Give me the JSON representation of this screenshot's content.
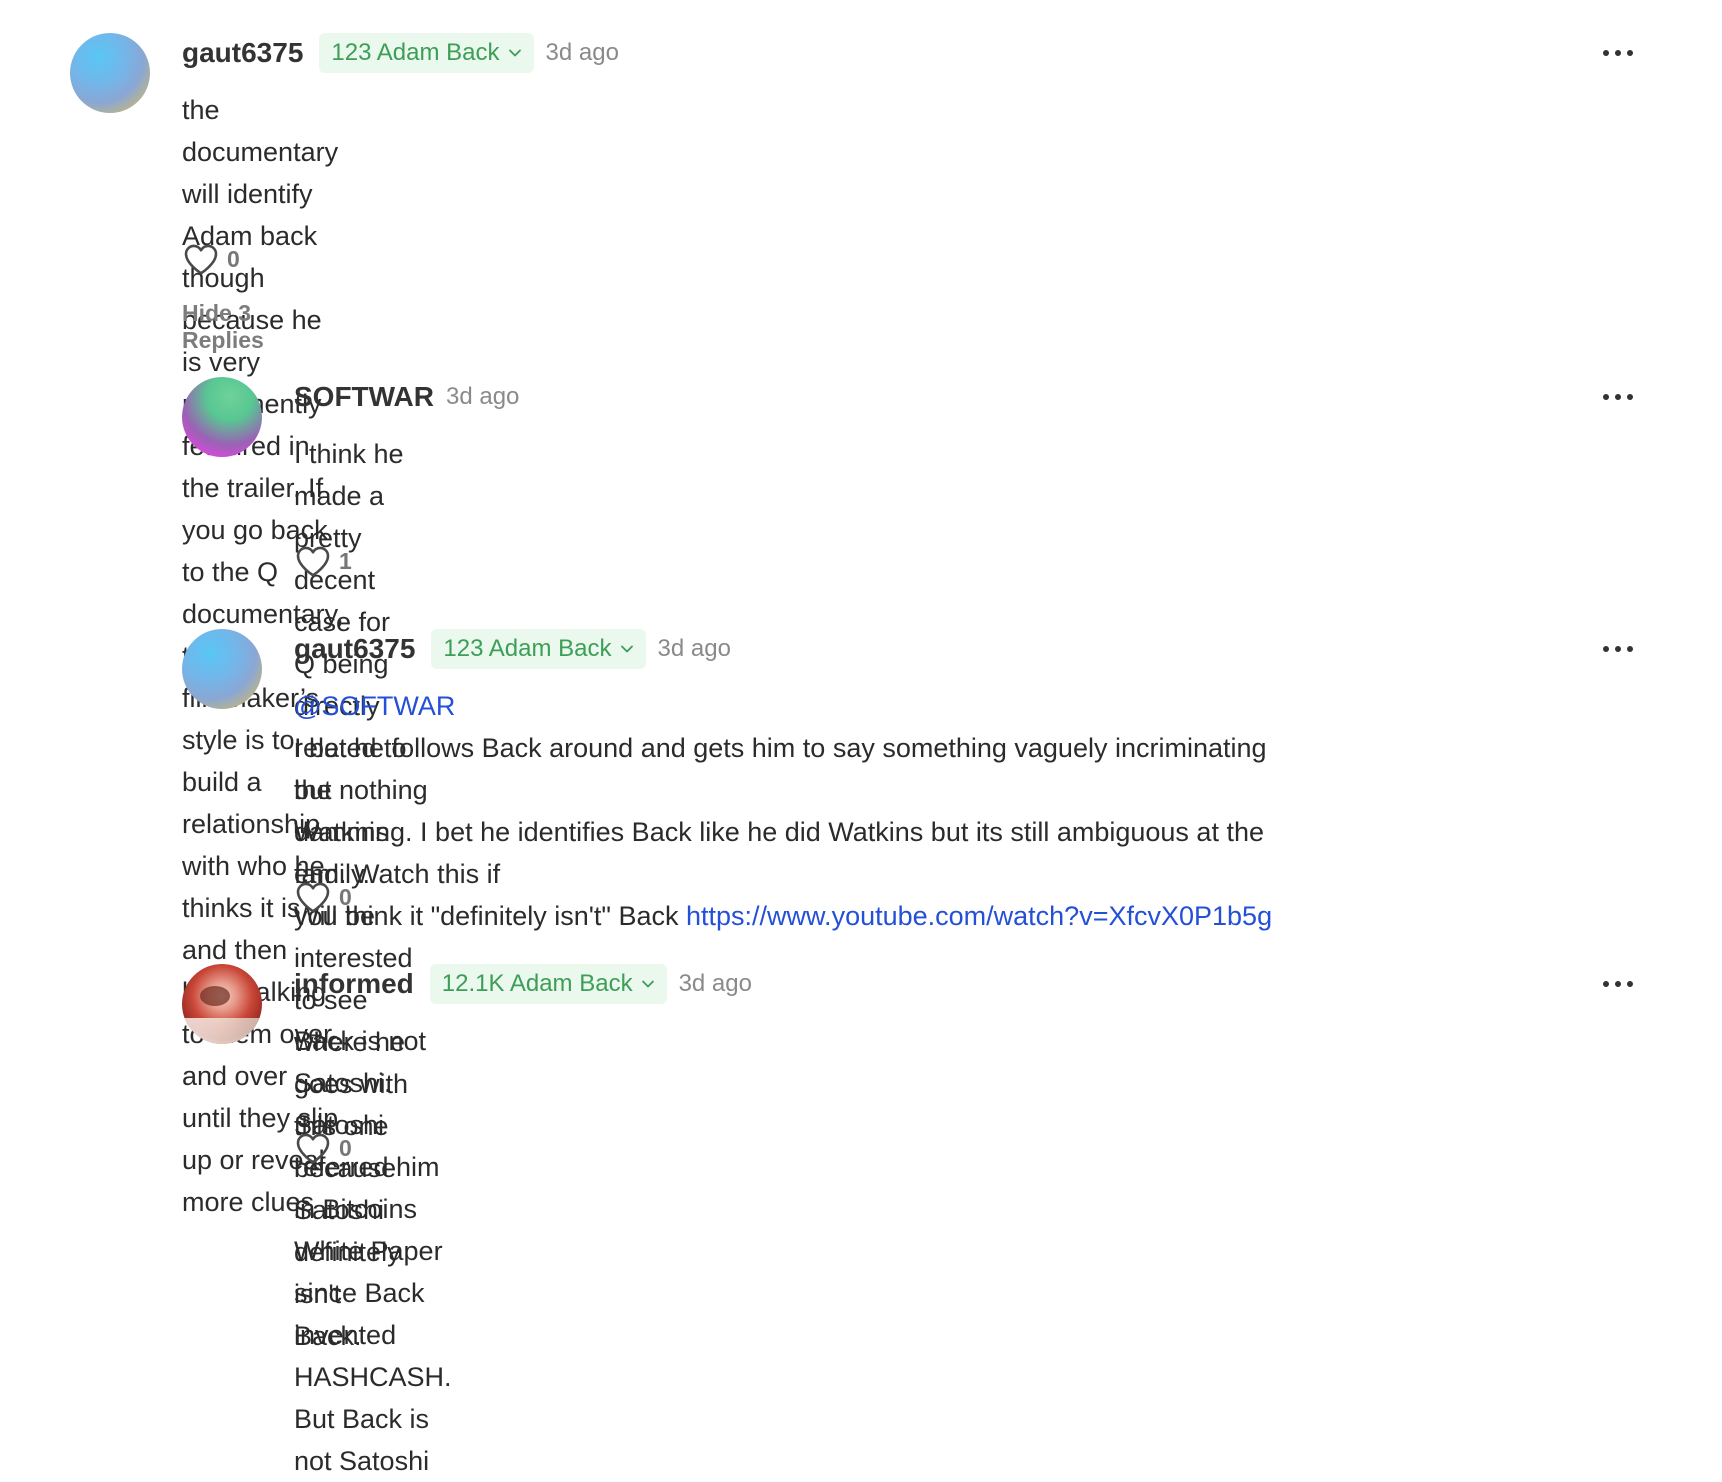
{
  "comments": [
    {
      "username": "gaut6375",
      "badge": "123 Adam Back",
      "time": "3d ago",
      "body_lines": [
        "the documentary will identify Adam back though because he is very prominently featured in the trailer. If",
        "you go back to the Q documentary, the filmmaker’s style is to build a relationship with who he thinks it is",
        "and then keep talking to them over and over until they slip up or reveal more clues"
      ],
      "likes": "0",
      "hide_replies": "Hide 3 Replies"
    },
    {
      "username": "SOFTWAR",
      "time": "3d ago",
      "body_lines": [
        "I think he made a pretty decent case for Q being directly related to the Watkins family. Will be",
        "interested to see where he goes with this one because Satoshi definitely isn't Back."
      ],
      "likes": "1"
    },
    {
      "username": "gaut6375",
      "badge": "123 Adam Back",
      "time": "3d ago",
      "mention": "@SOFTWAR",
      "body_lines": [
        "I bet he follows Back around and gets him to say something vaguely incriminating but nothing",
        "damming. I bet he identifies Back like he did Watkins but its still ambiguous at the end. Watch this if",
        "you think it \"definitely isn't\" Back "
      ],
      "link": "https://www.youtube.com/watch?v=XfcvX0P1b5g",
      "likes": "0"
    },
    {
      "username": "informed",
      "badge": "12.1K Adam Back",
      "time": "3d ago",
      "body_lines": [
        "Back is not Satoshi. Satoshi referred him in Bitcoins White Paper since Back invented HASHCASH.",
        "But Back is not Satoshi"
      ],
      "likes": "0"
    }
  ],
  "icons": {
    "like": "heart-icon",
    "more": "more-options-icon",
    "badge_chevron": "chevron-down-icon"
  },
  "colors": {
    "badge_bg": "#eaf8ee",
    "badge_text": "#3d9e56",
    "link": "#2450d8"
  }
}
